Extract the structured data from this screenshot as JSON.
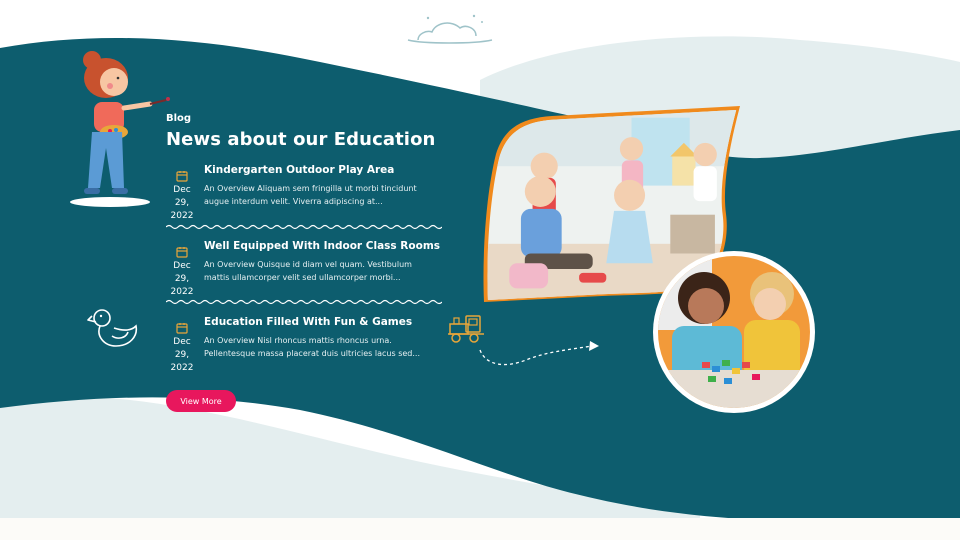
{
  "section": {
    "eyebrow": "Blog",
    "title": "News about our Education"
  },
  "posts": [
    {
      "title": "Kindergarten Outdoor Play Area",
      "date_line1": "Dec 29,",
      "date_line2": "2022",
      "excerpt": "An Overview Aliquam sem fringilla ut morbi tincidunt augue interdum velit. Viverra adipiscing at..."
    },
    {
      "title": "Well Equipped With Indoor Class Rooms",
      "date_line1": "Dec 29,",
      "date_line2": "2022",
      "excerpt": "An Overview Quisque id diam vel quam. Vestibulum mattis ullamcorper velit sed ullamcorper morbi..."
    },
    {
      "title": "Education Filled With Fun & Games",
      "date_line1": "Dec 29,",
      "date_line2": "2022",
      "excerpt": "An Overview Nisl rhoncus mattis rhoncus urna. Pellentesque massa placerat duis ultricies lacus sed..."
    }
  ],
  "view_more": {
    "label": "View More"
  },
  "icons": {
    "date": "calendar-icon",
    "decor_top": "cloud-icon",
    "decor_left": "duck-icon",
    "decor_toy": "toy-train-icon",
    "decor_arrow": "dashed-arrow-icon"
  },
  "colors": {
    "band": "#0d5d6e",
    "pale_wave": "#e4eeef",
    "accent_button": "#e8175d",
    "accent_icons": "#e8a63a",
    "photo_frame": "#f08a1c"
  }
}
